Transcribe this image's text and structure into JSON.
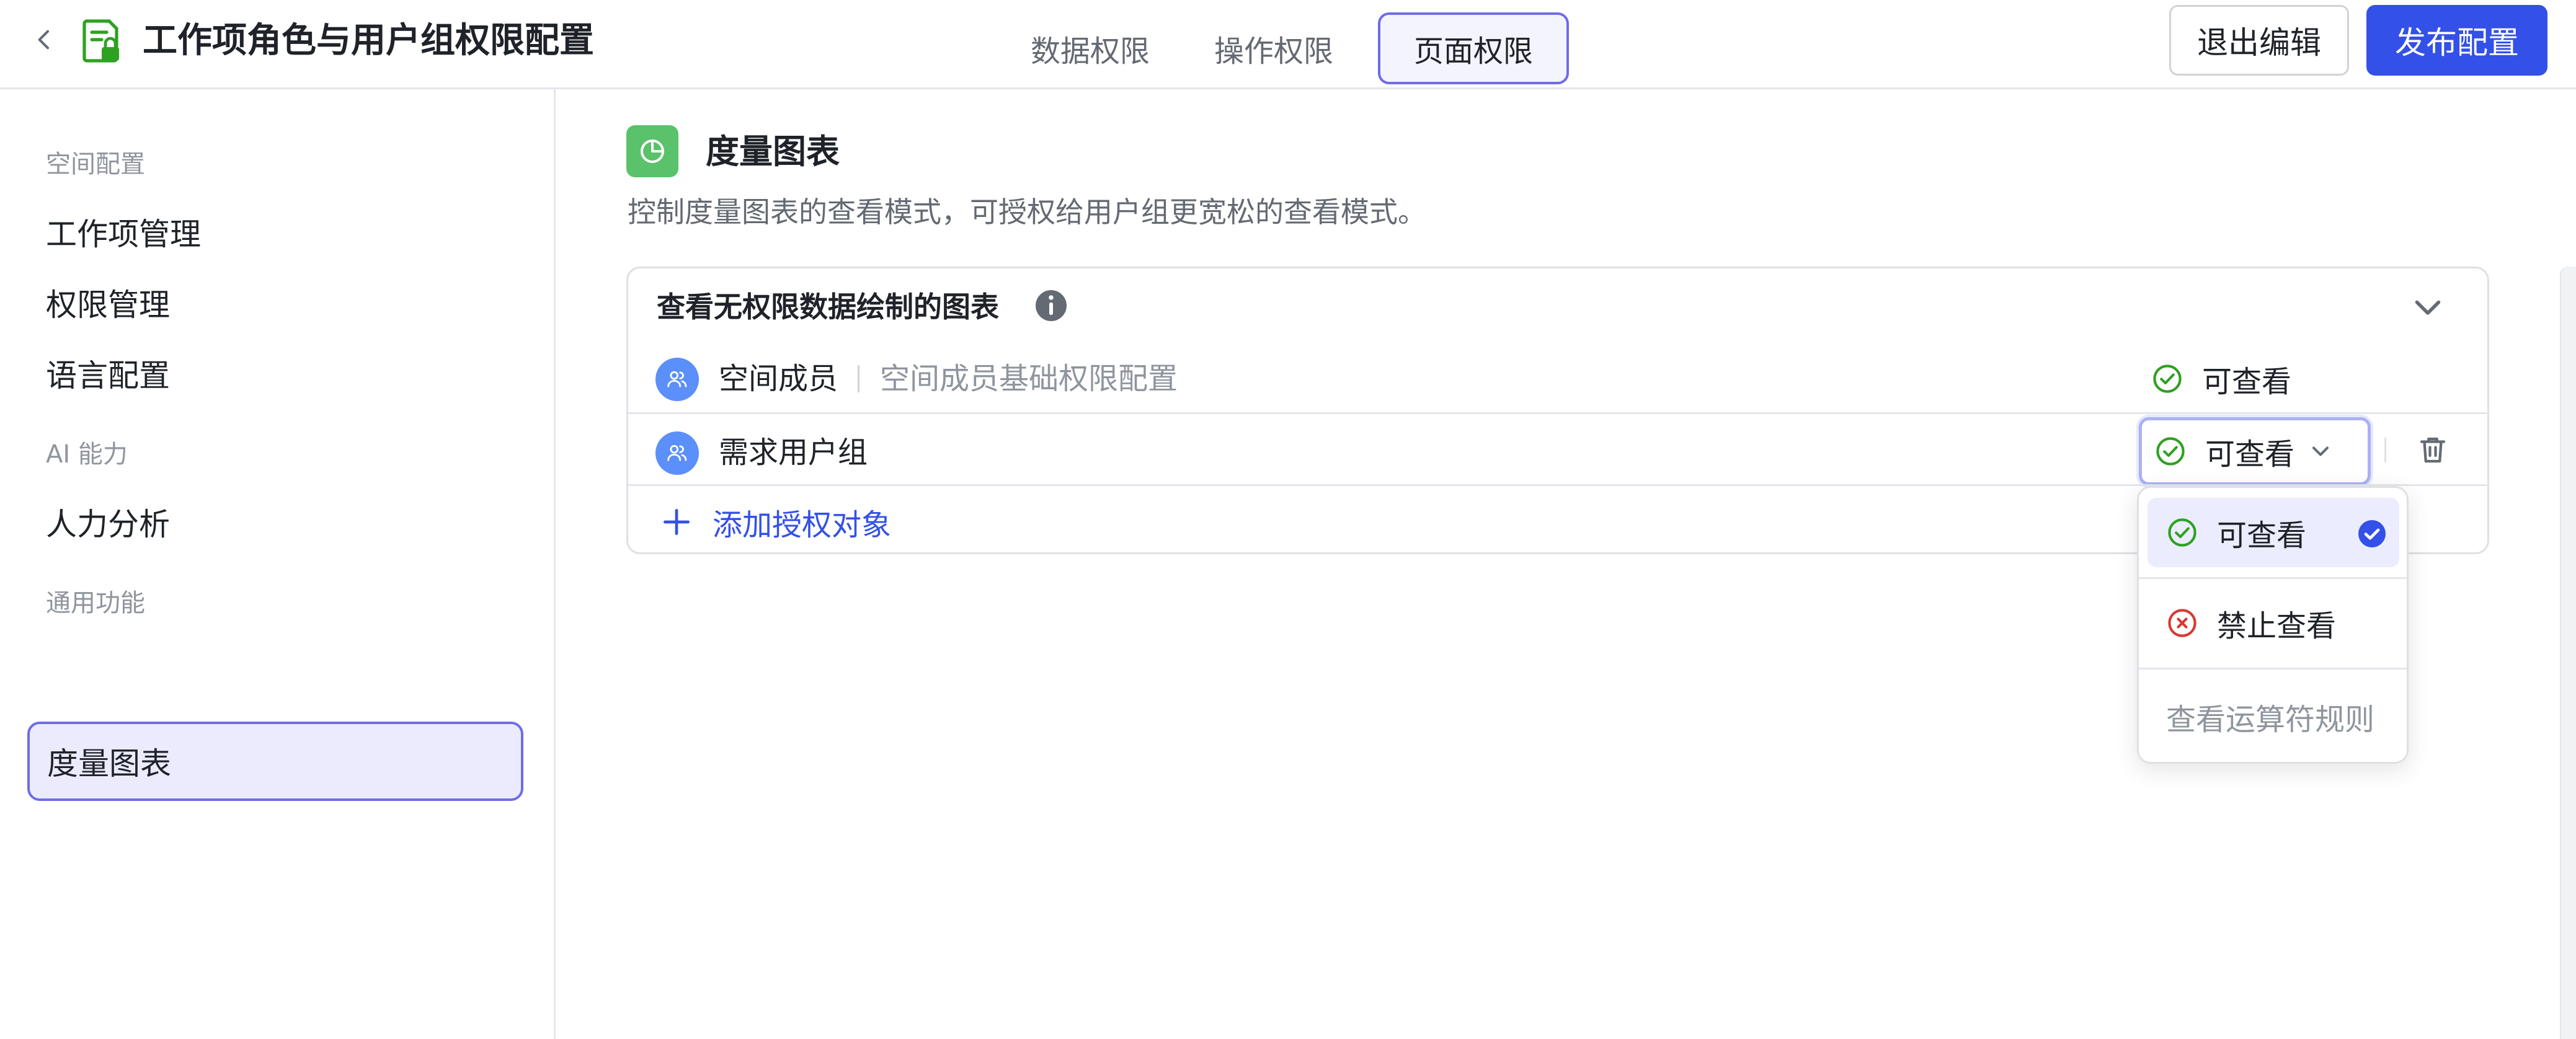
{
  "header": {
    "title": "工作项角色与用户组权限配置",
    "tabs": [
      {
        "label": "数据权限",
        "active": false
      },
      {
        "label": "操作权限",
        "active": false
      },
      {
        "label": "页面权限",
        "active": true
      }
    ],
    "exit_label": "退出编辑",
    "publish_label": "发布配置"
  },
  "sidebar": {
    "groups": [
      {
        "label": "空间配置",
        "items": [
          "工作项管理",
          "权限管理",
          "语言配置"
        ]
      },
      {
        "label": "AI 能力",
        "items": [
          "人力分析"
        ]
      },
      {
        "label": "通用功能",
        "items": [
          "度量图表"
        ]
      }
    ],
    "active_item": "度量图表"
  },
  "main": {
    "section_title": "度量图表",
    "section_desc": "控制度量图表的查看模式，可授权给用户组更宽松的查看模式。",
    "card": {
      "title": "查看无权限数据绘制的图表",
      "rows": [
        {
          "name": "空间成员",
          "sub": "空间成员基础权限配置",
          "permission": "可查看"
        },
        {
          "name": "需求用户组",
          "permission": "可查看"
        }
      ],
      "add_label": "添加授权对象"
    }
  },
  "dropdown": {
    "options": [
      {
        "label": "可查看",
        "selected": true
      },
      {
        "label": "禁止查看",
        "selected": false
      }
    ],
    "footer_link": "查看运算符规则"
  },
  "colors": {
    "accent": "#3350e8",
    "tab_active_border": "#6e6ce8",
    "success": "#2ea121",
    "danger": "#d83931",
    "section_icon": "#5ac26a",
    "avatar": "#5b8ff9"
  },
  "icons": {
    "back": "chevron-left-icon",
    "title": "document-lock-icon",
    "section": "pie-chart-icon",
    "info": "info-icon",
    "collapse": "chevron-down-icon",
    "avatar": "user-group-icon",
    "allow": "check-circle-icon",
    "deny": "x-circle-icon",
    "delete": "trash-icon",
    "add": "plus-icon",
    "selected": "check-filled-icon"
  }
}
